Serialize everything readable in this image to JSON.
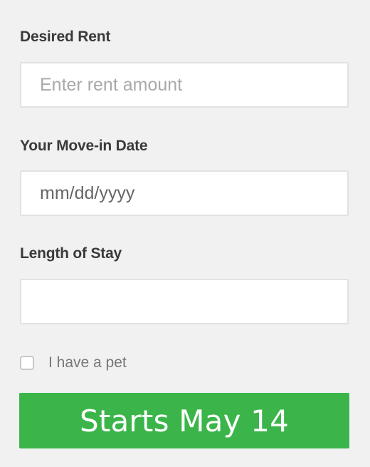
{
  "form": {
    "rent": {
      "label": "Desired Rent",
      "value": "",
      "placeholder": "Enter rent amount"
    },
    "move_in": {
      "label": "Your Move-in Date",
      "value": "",
      "placeholder": "mm/dd/yyyy"
    },
    "stay": {
      "label": "Length of Stay",
      "value": "",
      "placeholder": ""
    },
    "pet": {
      "label": "I have a pet",
      "checked": false
    },
    "submit_label": "Starts May 14"
  },
  "colors": {
    "background": "#f1f1f1",
    "button": "#3bb54a",
    "button_text": "#ffffff"
  }
}
